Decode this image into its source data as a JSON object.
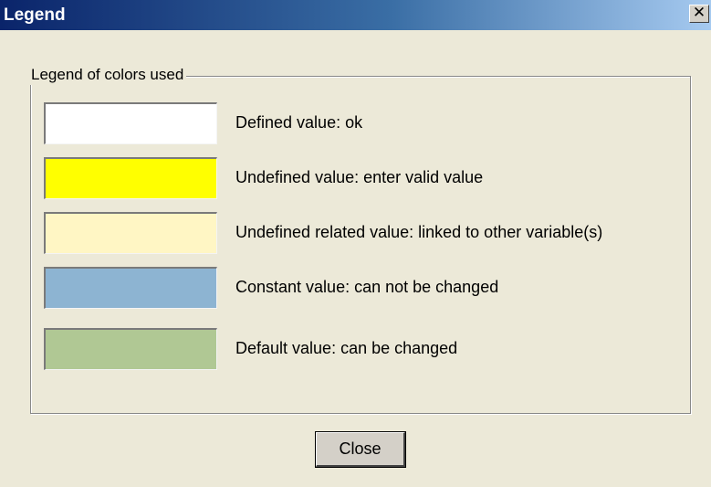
{
  "window": {
    "title": "Legend",
    "close_glyph": "✕"
  },
  "group": {
    "title": "Legend of colors used"
  },
  "legend": [
    {
      "color": "#ffffff",
      "label": "Defined value: ok"
    },
    {
      "color": "#ffff00",
      "label": "Undefined value: enter valid value"
    },
    {
      "color": "#fff6c4",
      "label": "Undefined related value: linked to other variable(s)"
    },
    {
      "color": "#8db4d2",
      "label": "Constant value: can not be changed"
    },
    {
      "color": "#b0c894",
      "label": "Default value: can be changed"
    }
  ],
  "buttons": {
    "close_label": "Close"
  },
  "icons": {
    "title_close": "close-icon"
  }
}
